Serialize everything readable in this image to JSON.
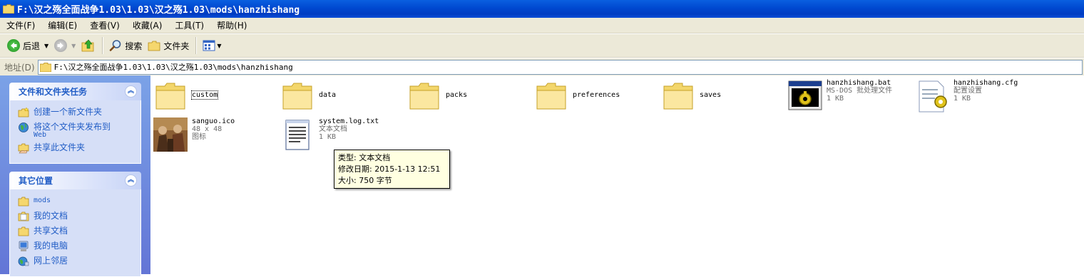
{
  "window": {
    "title": "F:\\汉之殇全面战争1.03\\1.03\\汉之殇1.03\\mods\\hanzhishang"
  },
  "menu": [
    "文件(F)",
    "编辑(E)",
    "查看(V)",
    "收藏(A)",
    "工具(T)",
    "帮助(H)"
  ],
  "toolbar": {
    "back_label": "后退",
    "search_label": "搜索",
    "folders_label": "文件夹"
  },
  "address": {
    "label": "地址(D)",
    "path": "F:\\汉之殇全面战争1.03\\1.03\\汉之殇1.03\\mods\\hanzhishang"
  },
  "tasks": {
    "title": "文件和文件夹任务",
    "items": [
      {
        "label": "创建一个新文件夹",
        "icon": "new-folder-icon"
      },
      {
        "label": "将这个文件夹发布到",
        "label2": "Web",
        "icon": "publish-web-icon"
      },
      {
        "label": "共享此文件夹",
        "icon": "share-folder-icon"
      }
    ]
  },
  "other_places": {
    "title": "其它位置",
    "items": [
      {
        "label": "mods",
        "icon": "folder-icon"
      },
      {
        "label": "我的文档",
        "icon": "my-documents-icon"
      },
      {
        "label": "共享文档",
        "icon": "shared-documents-icon"
      },
      {
        "label": "我的电脑",
        "icon": "my-computer-icon"
      },
      {
        "label": "网上邻居",
        "icon": "network-places-icon"
      }
    ]
  },
  "files": [
    {
      "name": "custom",
      "type": "folder"
    },
    {
      "name": "data",
      "type": "folder"
    },
    {
      "name": "packs",
      "type": "folder"
    },
    {
      "name": "preferences",
      "type": "folder"
    },
    {
      "name": "saves",
      "type": "folder"
    },
    {
      "name": "hanzhishang.bat",
      "desc": "MS-DOS 批处理文件",
      "size": "1 KB",
      "type": "bat"
    },
    {
      "name": "hanzhishang.cfg",
      "desc": "配置设置",
      "size": "1 KB",
      "type": "cfg"
    },
    {
      "name": "sanguo.ico",
      "desc": "48 x 48",
      "size": "图标",
      "type": "ico"
    },
    {
      "name": "system.log.txt",
      "desc": "文本文档",
      "size": "1 KB",
      "type": "txt"
    }
  ],
  "tooltip": {
    "line1": "类型: 文本文档",
    "line2": "修改日期: 2015-1-13 12:51",
    "line3": "大小: 750 字节"
  },
  "colors": {
    "titlebar": "#0048d0",
    "taskpane": "#6f8fdf",
    "panel_body": "#d6dff7",
    "link": "#215dc6",
    "tooltip_bg": "#ffffe1"
  }
}
